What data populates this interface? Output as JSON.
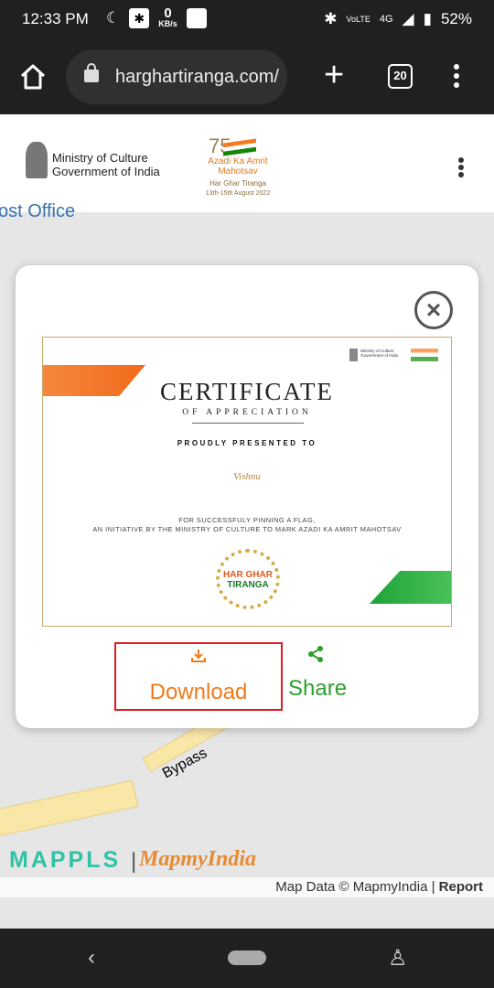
{
  "status_bar": {
    "time": "12:33 PM",
    "net_speed": "0",
    "net_unit": "KB/s",
    "battery": "52%",
    "network": "4G",
    "volte": "VoLTE"
  },
  "browser": {
    "url": "harghartiranga.com/",
    "tab_count": "20"
  },
  "site_header": {
    "ministry_line1": "Ministry of Culture",
    "ministry_line2": "Government of India",
    "azadi_title": "Azadi Ka Amrit Mahotsav",
    "azadi_sub1": "Har Ghar Tiranga",
    "azadi_sub2": "13th-15th August 2022"
  },
  "map": {
    "label_top": "ost Office",
    "road_label": "Bypass",
    "brand1": "MAPPLS",
    "brand2": "MapmyIndia",
    "attribution": "Map Data © MapmyIndia | ",
    "report": "Report"
  },
  "certificate": {
    "title": "CERTIFICATE",
    "subtitle": "OF APPRECIATION",
    "presented": "PROUDLY PRESENTED TO",
    "name": "Vishnu",
    "desc_line1": "FOR SUCCESSFULY PINNING A FLAG,",
    "desc_line2": "AN INITIATIVE BY THE MINISTRY OF CULTURE TO MARK AZADI KA AMRIT MAHOTSAV",
    "badge_line1": "HAR GHAR",
    "badge_line2": "TIRANGA",
    "mini_line1": "Ministry of Culture",
    "mini_line2": "Government of India"
  },
  "actions": {
    "download": "Download",
    "share": "Share"
  },
  "colors": {
    "download": "#f07a1a",
    "share": "#2ca02c",
    "highlight": "#e01b24"
  }
}
